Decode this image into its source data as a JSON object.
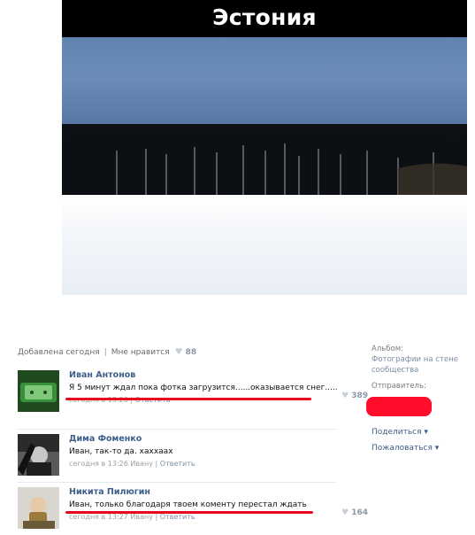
{
  "photo": {
    "caption": "Эстония"
  },
  "meta": {
    "added": "Добавлена сегодня",
    "like_label": "Мне нравится",
    "likes": "88"
  },
  "sidebar": {
    "album_label": "Альбом:",
    "album_name": "Фотографии на стене сообщества",
    "sender_label": "Отправитель:",
    "share": "Поделиться ▾",
    "report": "Пожаловаться ▾"
  },
  "comments": [
    {
      "name": "Иван Антонов",
      "text": "Я 5 минут ждал пока фотка загрузится......оказывается снег.....",
      "time": "сегодня в 13:26",
      "reply": "Ответить",
      "likes": "389"
    },
    {
      "name": "Дима Фоменко",
      "text": "Иван, так-то да. хаххаах",
      "time": "сегодня в 13:26 Ивану",
      "reply": "Ответить",
      "likes": ""
    },
    {
      "name": "Никита Пилюгин",
      "text": "Иван, только благодаря твоем коменту перестал ждать",
      "time": "сегодня в 13:27 Ивану",
      "reply": "Ответить",
      "likes": "164"
    }
  ],
  "colors": {
    "link": "#3c5f8b",
    "highlight": "#e5091b"
  }
}
